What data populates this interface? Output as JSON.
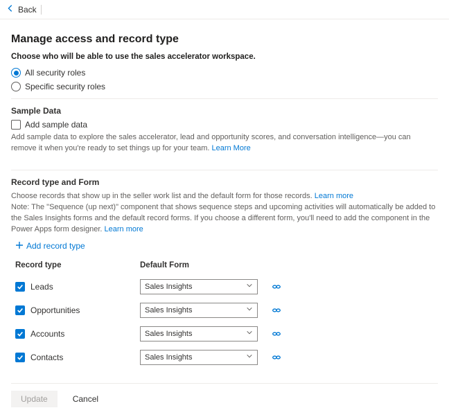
{
  "topbar": {
    "back": "Back"
  },
  "page": {
    "title": "Manage access and record type",
    "subtitle": "Choose who will be able to use the sales accelerator workspace."
  },
  "roles": {
    "option_all": "All security roles",
    "option_specific": "Specific security roles"
  },
  "sample": {
    "title": "Sample Data",
    "checkbox_label": "Add sample data",
    "help": "Add sample data to explore the sales accelerator, lead and opportunity scores, and conversation intelligence—you can remove it when you're ready to set things up for your team. ",
    "learn_more": "Learn More"
  },
  "record": {
    "title": "Record type and Form",
    "help1": "Choose records that show up in the seller work list and the default form for those records. ",
    "learn_more1": "Learn more",
    "help2a": "Note: The \"Sequence (up next)\" component that shows sequence steps and upcoming activities will automatically be added to the Sales Insights forms and the default record forms. If you choose a different form, you'll need to add the component in the Power Apps form designer. ",
    "learn_more2": "Learn more",
    "add_label": "Add record type",
    "col_type": "Record type",
    "col_form": "Default Form",
    "rows": [
      {
        "label": "Leads",
        "form": "Sales Insights"
      },
      {
        "label": "Opportunities",
        "form": "Sales Insights"
      },
      {
        "label": "Accounts",
        "form": "Sales Insights"
      },
      {
        "label": "Contacts",
        "form": "Sales Insights"
      }
    ]
  },
  "footer": {
    "update": "Update",
    "cancel": "Cancel"
  }
}
